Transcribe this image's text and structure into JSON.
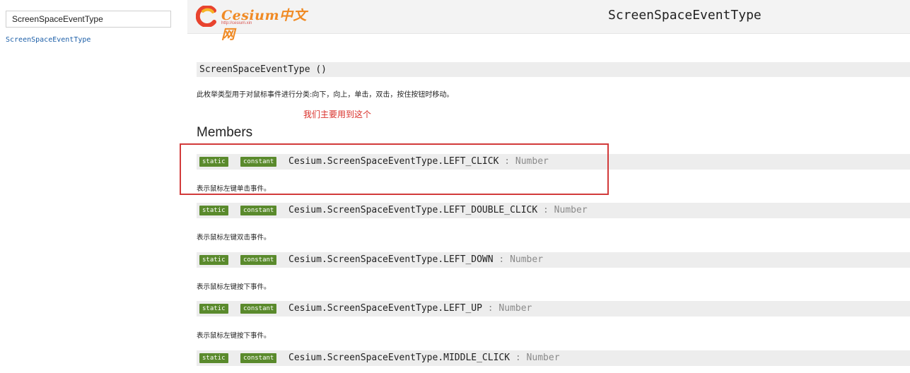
{
  "sidebar": {
    "search_value": "ScreenSpaceEventType",
    "link_label": "ScreenSpaceEventType"
  },
  "header": {
    "logo_text": "Cesium中文网",
    "logo_url": "http://cesium.xin",
    "title": "ScreenSpaceEventType"
  },
  "main": {
    "signature": "ScreenSpaceEventType ()",
    "description": "此枚举类型用于对鼠标事件进行分类:向下，向上，单击，双击，按住按钮时移动。",
    "annotation_note": "我们主要用到这个",
    "members_heading": "Members",
    "members": [
      {
        "static": "static",
        "constant": "constant",
        "name": "Cesium.ScreenSpaceEventType.LEFT_CLICK",
        "type": " : Number",
        "desc": "表示鼠标左键单击事件。"
      },
      {
        "static": "static",
        "constant": "constant",
        "name": "Cesium.ScreenSpaceEventType.LEFT_DOUBLE_CLICK",
        "type": " : Number",
        "desc": "表示鼠标左键双击事件。"
      },
      {
        "static": "static",
        "constant": "constant",
        "name": "Cesium.ScreenSpaceEventType.LEFT_DOWN",
        "type": " : Number",
        "desc": "表示鼠标左键按下事件。"
      },
      {
        "static": "static",
        "constant": "constant",
        "name": "Cesium.ScreenSpaceEventType.LEFT_UP",
        "type": " : Number",
        "desc": "表示鼠标左键按下事件。"
      },
      {
        "static": "static",
        "constant": "constant",
        "name": "Cesium.ScreenSpaceEventType.MIDDLE_CLICK",
        "type": " : Number",
        "desc": ""
      }
    ]
  },
  "colors": {
    "tag_green": "#5a8a2c",
    "annotation_red": "#d9302a",
    "link_blue": "#1d5fa8",
    "logo_orange": "#f08a24"
  }
}
